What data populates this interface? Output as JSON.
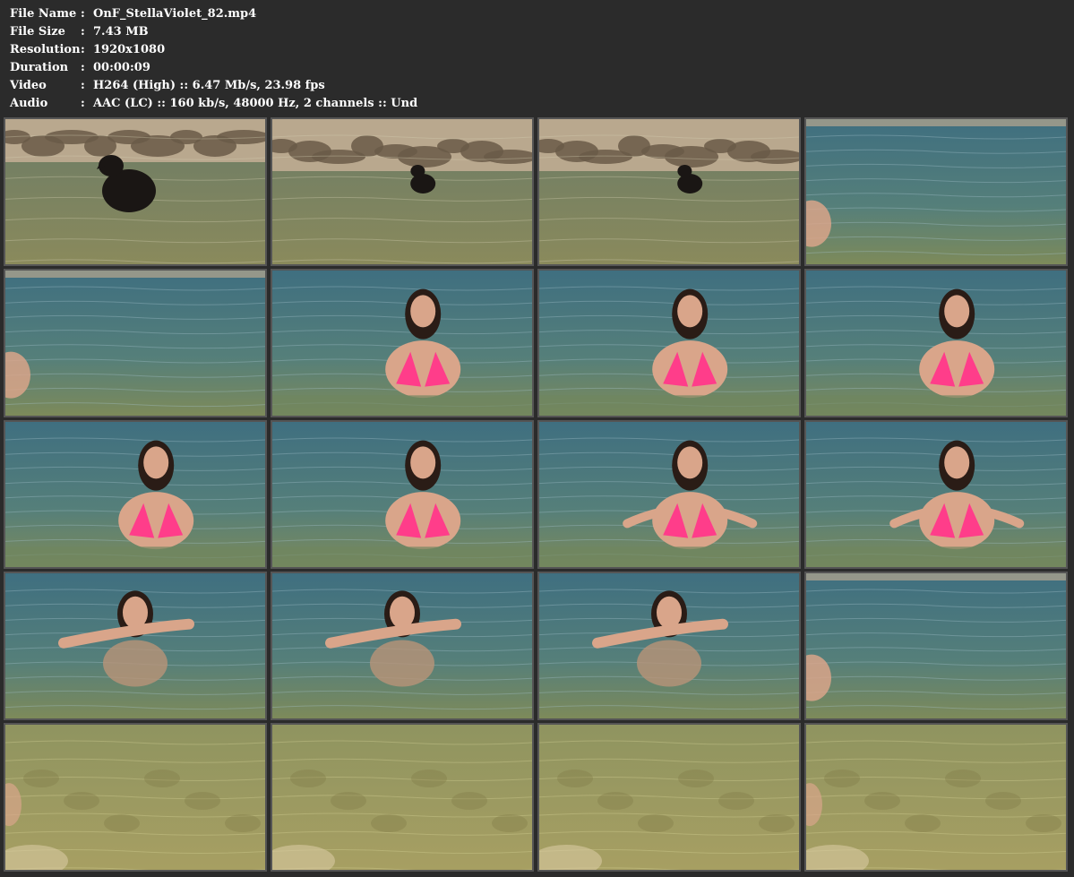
{
  "info": [
    {
      "key": "File Name",
      "sep": ":",
      "value": "OnF_StellaViolet_82.mp4"
    },
    {
      "key": "File Size",
      "sep": ":",
      "value": "7.43 MB"
    },
    {
      "key": "Resolution",
      "sep": ":",
      "value": "1920x1080"
    },
    {
      "key": "Duration",
      "sep": ":",
      "value": "00:00:09"
    },
    {
      "key": "Video",
      "sep": ":",
      "value": "H264 (High) :: 6.47 Mb/s, 23.98 fps"
    },
    {
      "key": "Audio",
      "sep": ":",
      "value": "AAC (LC) :: 160 kb/s, 48000 Hz, 2 channels :: Und"
    }
  ],
  "thumbnails": [
    {
      "scene": "dog-shore-close"
    },
    {
      "scene": "dog-shore"
    },
    {
      "scene": "dog-shore"
    },
    {
      "scene": "water-edge-figure"
    },
    {
      "scene": "water-edge-figure"
    },
    {
      "scene": "person-bikini"
    },
    {
      "scene": "person-bikini"
    },
    {
      "scene": "person-bikini"
    },
    {
      "scene": "person-bikini"
    },
    {
      "scene": "person-bikini"
    },
    {
      "scene": "person-bikini-arms"
    },
    {
      "scene": "person-bikini-arms"
    },
    {
      "scene": "person-swimming"
    },
    {
      "scene": "person-swimming"
    },
    {
      "scene": "person-swimming"
    },
    {
      "scene": "water-edge-figure"
    },
    {
      "scene": "murky-water-edge"
    },
    {
      "scene": "murky-water"
    },
    {
      "scene": "murky-water"
    },
    {
      "scene": "murky-water-edge"
    }
  ],
  "colors": {
    "background": "#2b2b2b",
    "text": "#ffffff",
    "water_blue": "#4d7a86",
    "water_green": "#7a8a55",
    "murky": "#9c9a5a",
    "rock": "#6a5a48",
    "sand": "#b9a88e",
    "skin": "#d9a58a",
    "bikini": "#ff3d8a",
    "hair": "#2a1c16",
    "dog": "#1a1614"
  }
}
